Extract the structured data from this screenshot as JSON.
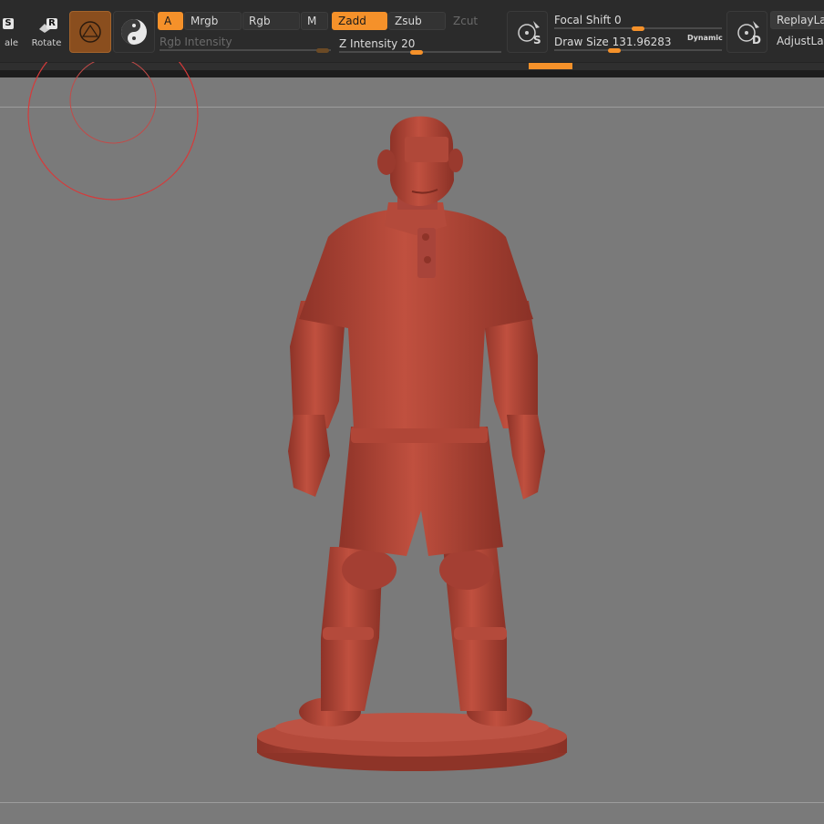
{
  "shelf": {
    "scale_label": "ale",
    "scale_key": "S",
    "rotate_label": "Rotate",
    "rotate_key": "R",
    "channels": {
      "a": "A",
      "mrgb": "Mrgb",
      "rgb": "Rgb",
      "m": "M",
      "zadd": "Zadd",
      "zsub": "Zsub",
      "zcut": "Zcut"
    },
    "rgb_intensity": {
      "label": "Rgb Intensity",
      "value": "",
      "level": 0.95
    },
    "z_intensity": {
      "label": "Z Intensity",
      "value": "20",
      "level": 0.48
    },
    "focal_shift": {
      "label": "Focal Shift",
      "value": "0",
      "level": 0.5
    },
    "draw_size": {
      "label": "Draw Size",
      "value": "131.96283",
      "level": 0.36
    },
    "dynamic_label": "Dynamic",
    "s_key": "S",
    "d_key": "D",
    "replay_last": "ReplayLas",
    "adjust_last": "AdjustLast"
  },
  "colors": {
    "accent": "#f5912a",
    "shelf_bg": "#2b2b2b",
    "canvas_bg": "#7a7a7a",
    "brush_cursor": "#d63a3a",
    "model_clay": "#b5473a"
  },
  "icons": {
    "scale": "scale-icon",
    "rotate": "rotate-icon",
    "brush": "brush-icon",
    "material": "material-sphere-icon",
    "lightbox_s": "lightbox-s-icon",
    "lightbox_d": "lightbox-d-icon"
  }
}
